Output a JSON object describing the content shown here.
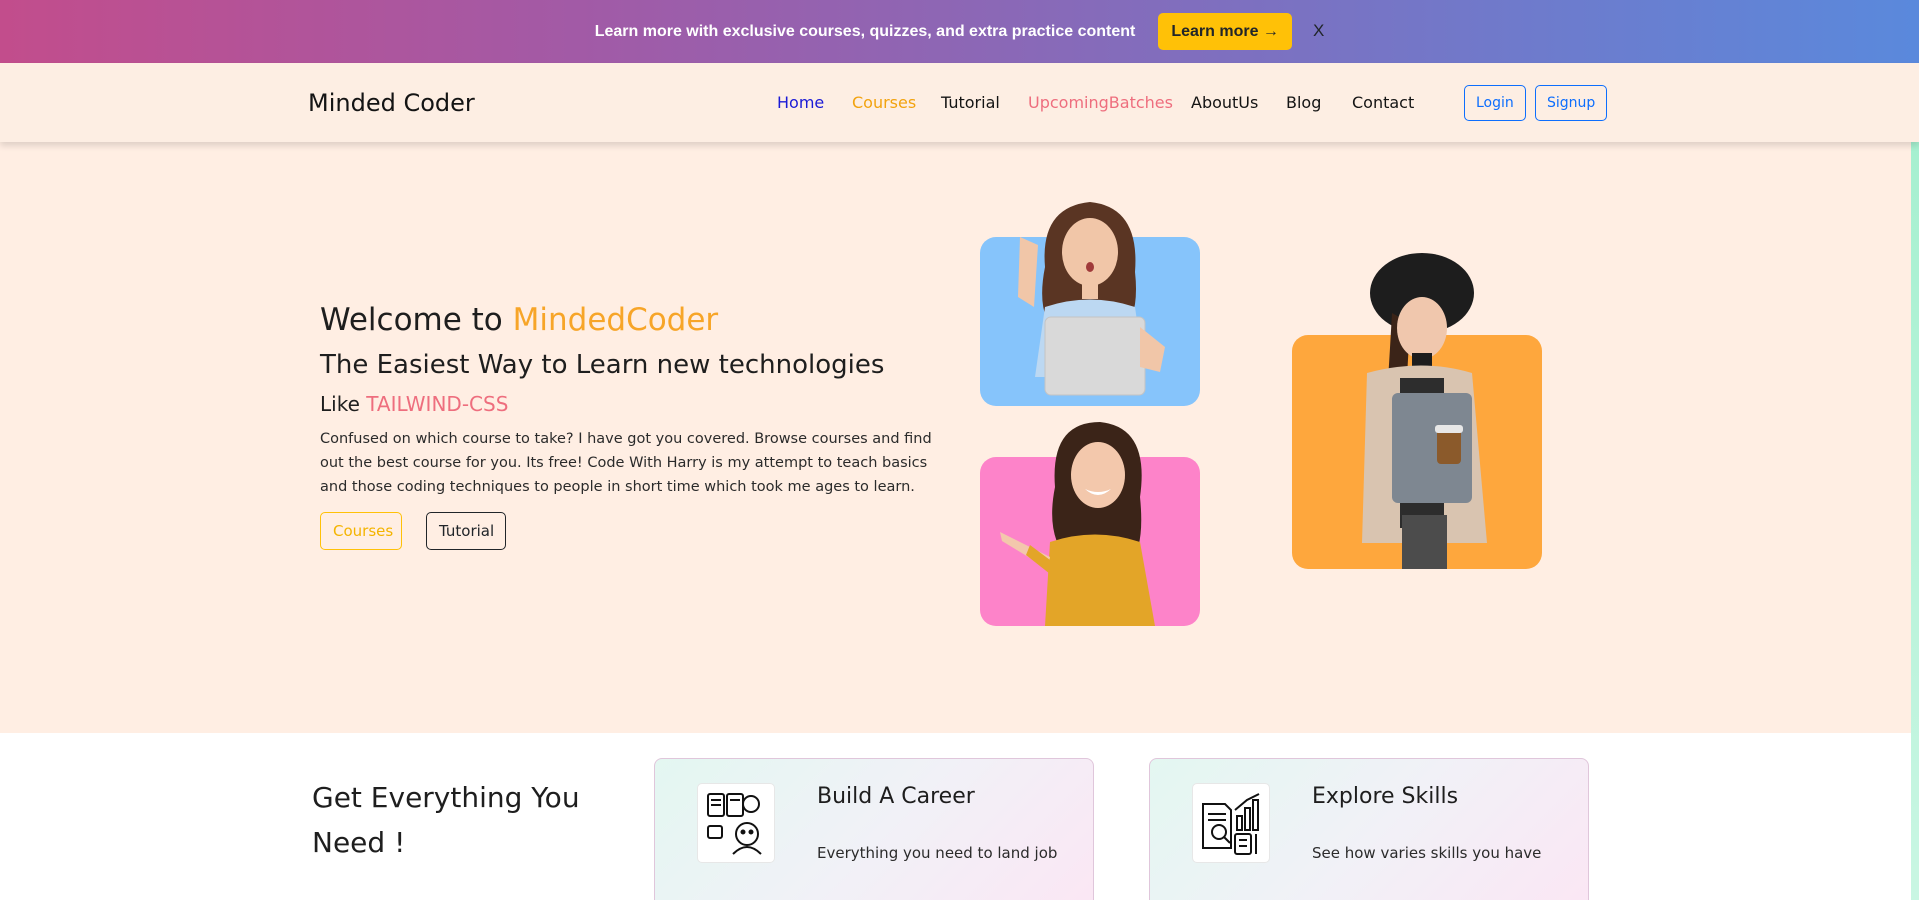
{
  "banner": {
    "text": "Learn more with exclusive courses, quizzes, and extra practice content",
    "button_label": "Learn more →",
    "close_label": "X"
  },
  "navbar": {
    "brand": "Minded Coder",
    "items": [
      {
        "label": "Home",
        "color": "#1a1ad6"
      },
      {
        "label": "Courses",
        "color": "#f2a30f"
      },
      {
        "label": "Tutorial",
        "color": "#141414"
      },
      {
        "label": "UpcomingBatches",
        "color": "#ee6e7e"
      },
      {
        "label": "AboutUs",
        "color": "#141414"
      },
      {
        "label": "Blog",
        "color": "#141414"
      },
      {
        "label": "Contact",
        "color": "#141414"
      }
    ],
    "login_label": "Login",
    "signup_label": "Signup"
  },
  "hero": {
    "welcome_prefix": "Welcome to ",
    "welcome_brand": "MindedCoder",
    "subtitle": "The Easiest Way to Learn new technologies",
    "like_prefix": "Like ",
    "like_tech": "TAILWIND-CSS",
    "description": "Confused on which course to take? I have got you covered. Browse courses and find out the best course for you. Its free! Code With Harry is my attempt to teach basics and those coding techniques to people in short time which took me ages to learn.",
    "courses_button": "Courses",
    "tutorial_button": "Tutorial"
  },
  "features": {
    "title": "Get Everything You Need !",
    "cards": [
      {
        "title": "Build A Career",
        "text": "Everything you need to land job",
        "icon": "career-icon"
      },
      {
        "title": "Explore Skills",
        "text": "See how varies skills you have",
        "icon": "skills-icon"
      }
    ]
  },
  "colors": {
    "accent_orange": "#f7a528",
    "accent_pink": "#ee6e7e",
    "link_blue": "#0d6efd",
    "banner_button": "#ffc107"
  }
}
